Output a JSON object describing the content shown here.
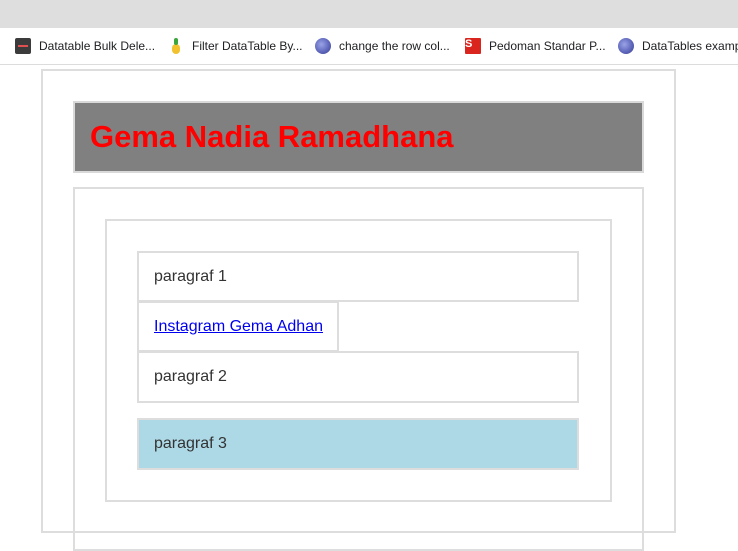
{
  "bookmarks": [
    {
      "label": "Datatable Bulk Dele...",
      "icon": "dark-logo-icon"
    },
    {
      "label": "Filter DataTable By...",
      "icon": "pineapple-icon"
    },
    {
      "label": "change the row col...",
      "icon": "globe-icon"
    },
    {
      "label": "Pedoman Standar P...",
      "icon": "red-s-icon",
      "icon_text": "S"
    },
    {
      "label": "DataTables examp",
      "icon": "globe-icon"
    }
  ],
  "page": {
    "title": "Gema Nadia Ramadhana",
    "paragraphs": [
      "paragraf 1",
      "paragraf 2",
      "paragraf 3"
    ],
    "link_text": "Instagram Gema Adhan"
  },
  "colors": {
    "header_bg": "#808080",
    "title_color": "#ff0000",
    "highlight_bg": "#add8e6",
    "link_color": "#0000ee"
  }
}
